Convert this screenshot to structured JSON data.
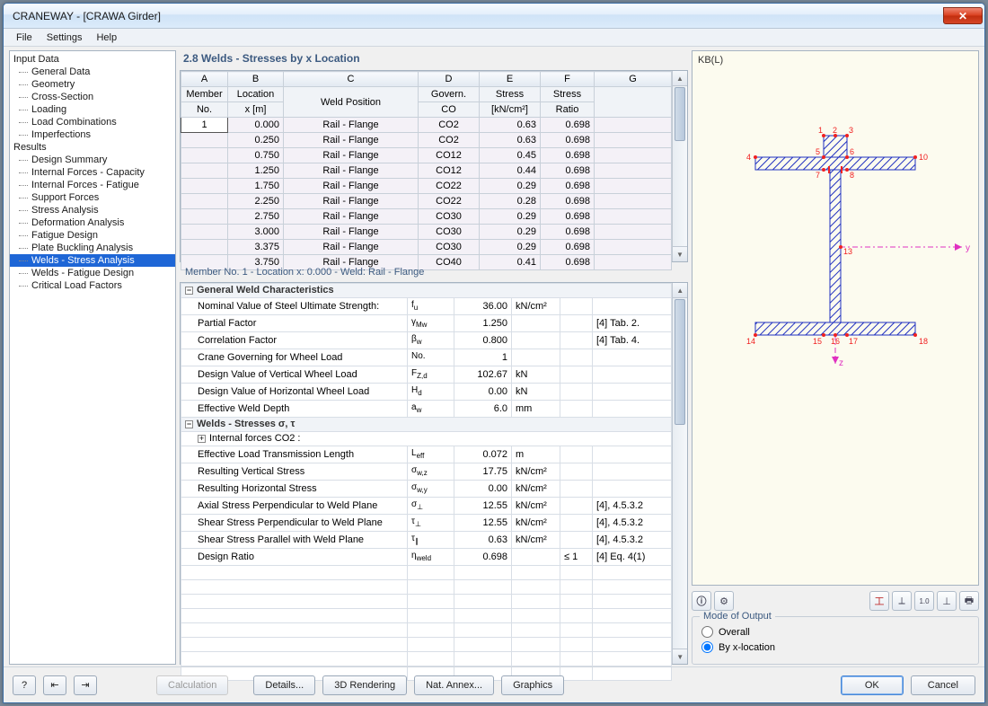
{
  "title": "CRANEWAY - [CRAWA Girder]",
  "menu": {
    "file": "File",
    "settings": "Settings",
    "help": "Help"
  },
  "nav": {
    "input_data": "Input Data",
    "general_data": "General Data",
    "geometry": "Geometry",
    "cross_section": "Cross-Section",
    "loading": "Loading",
    "load_comb": "Load Combinations",
    "imperf": "Imperfections",
    "results": "Results",
    "design_summary": "Design Summary",
    "int_cap": "Internal Forces - Capacity",
    "int_fat": "Internal Forces - Fatigue",
    "support": "Support Forces",
    "stress": "Stress Analysis",
    "deform": "Deformation Analysis",
    "fatigue": "Fatigue Design",
    "plate": "Plate Buckling Analysis",
    "welds_stress": "Welds - Stress Analysis",
    "welds_fat": "Welds - Fatigue Design",
    "crit": "Critical Load Factors"
  },
  "section_title": "2.8 Welds - Stresses by x Location",
  "grid": {
    "cols": {
      "A": "A",
      "B": "B",
      "C": "C",
      "D": "D",
      "E": "E",
      "F": "F",
      "G": "G"
    },
    "hdr": {
      "member": "Member",
      "no": "No.",
      "loc": "Location",
      "x": "x [m]",
      "weld": "Weld Position",
      "gov": "Govern.",
      "co": "CO",
      "stress": "Stress",
      "unit": "[kN/cm²]",
      "ratio": "Stress",
      "ratio2": "Ratio"
    },
    "rows": [
      {
        "m": "1",
        "x": "0.000",
        "wp": "Rail - Flange",
        "co": "CO2",
        "s": "0.63",
        "r": "0.698"
      },
      {
        "m": "",
        "x": "0.250",
        "wp": "Rail - Flange",
        "co": "CO2",
        "s": "0.63",
        "r": "0.698"
      },
      {
        "m": "",
        "x": "0.750",
        "wp": "Rail - Flange",
        "co": "CO12",
        "s": "0.45",
        "r": "0.698"
      },
      {
        "m": "",
        "x": "1.250",
        "wp": "Rail - Flange",
        "co": "CO12",
        "s": "0.44",
        "r": "0.698"
      },
      {
        "m": "",
        "x": "1.750",
        "wp": "Rail - Flange",
        "co": "CO22",
        "s": "0.29",
        "r": "0.698"
      },
      {
        "m": "",
        "x": "2.250",
        "wp": "Rail - Flange",
        "co": "CO22",
        "s": "0.28",
        "r": "0.698"
      },
      {
        "m": "",
        "x": "2.750",
        "wp": "Rail - Flange",
        "co": "CO30",
        "s": "0.29",
        "r": "0.698"
      },
      {
        "m": "",
        "x": "3.000",
        "wp": "Rail - Flange",
        "co": "CO30",
        "s": "0.29",
        "r": "0.698"
      },
      {
        "m": "",
        "x": "3.375",
        "wp": "Rail - Flange",
        "co": "CO30",
        "s": "0.29",
        "r": "0.698"
      },
      {
        "m": "",
        "x": "3.750",
        "wp": "Rail - Flange",
        "co": "CO40",
        "s": "0.41",
        "r": "0.698"
      }
    ]
  },
  "detail_title": "Member No.  1  -  Location x:  0.000  -  Weld: Rail - Flange",
  "details": {
    "group1": "General Weld Characteristics",
    "rows1": [
      {
        "p": "Nominal Value of Steel Ultimate Strength:",
        "s": "f",
        "sub": "u",
        "v": "36.00",
        "u": "kN/cm²",
        "ref": ""
      },
      {
        "p": "Partial Factor",
        "s": "γ",
        "sub": "Mw",
        "v": "1.250",
        "u": "",
        "ref": "[4] Tab. 2."
      },
      {
        "p": "Correlation Factor",
        "s": "β",
        "sub": "w",
        "v": "0.800",
        "u": "",
        "ref": "[4] Tab. 4."
      },
      {
        "p": "Crane Governing for Wheel Load",
        "s": "No.",
        "sub": "",
        "v": "1",
        "u": "",
        "ref": ""
      },
      {
        "p": "Design Value of Vertical Wheel Load",
        "s": "F",
        "sub": "Z,d",
        "v": "102.67",
        "u": "kN",
        "ref": ""
      },
      {
        "p": "Design Value of Horizontal Wheel Load",
        "s": "H",
        "sub": "d",
        "v": "0.00",
        "u": "kN",
        "ref": ""
      },
      {
        "p": "Effective Weld Depth",
        "s": "a",
        "sub": "w",
        "v": "6.0",
        "u": "mm",
        "ref": ""
      }
    ],
    "group2": "Welds - Stresses σ, τ",
    "sub2": "Internal forces CO2 :",
    "rows2": [
      {
        "p": "Effective Load Transmission Length",
        "s": "L",
        "sub": "eff",
        "v": "0.072",
        "u": "m",
        "ref": ""
      },
      {
        "p": "Resulting Vertical Stress",
        "s": "σ",
        "sub": "w,z",
        "v": "17.75",
        "u": "kN/cm²",
        "ref": ""
      },
      {
        "p": "Resulting Horizontal Stress",
        "s": "σ",
        "sub": "w,y",
        "v": "0.00",
        "u": "kN/cm²",
        "ref": ""
      },
      {
        "p": "Axial Stress Perpendicular to Weld Plane",
        "s": "σ",
        "sub": "⊥",
        "v": "12.55",
        "u": "kN/cm²",
        "ref": "[4], 4.5.3.2"
      },
      {
        "p": "Shear Stress Perpendicular to Weld Plane",
        "s": "τ",
        "sub": "⊥",
        "v": "12.55",
        "u": "kN/cm²",
        "ref": "[4], 4.5.3.2"
      },
      {
        "p": "Shear Stress Parallel with Weld Plane",
        "s": "τ",
        "sub": "∥",
        "v": "0.63",
        "u": "kN/cm²",
        "ref": "[4], 4.5.3.2"
      },
      {
        "p": "Design Ratio",
        "s": "η",
        "sub": "weld",
        "v": "0.698",
        "u": "",
        "lim": "≤ 1",
        "ref": "[4] Eq. 4(1)"
      }
    ]
  },
  "viewer": {
    "label": "KB(L)",
    "y": "y",
    "z": "z"
  },
  "modebox": {
    "title": "Mode of Output",
    "overall": "Overall",
    "byx": "By x-location"
  },
  "footer": {
    "calc": "Calculation",
    "details": "Details...",
    "render": "3D Rendering",
    "annex": "Nat. Annex...",
    "graphics": "Graphics",
    "ok": "OK",
    "cancel": "Cancel"
  },
  "chart_data": {
    "type": "table",
    "title": "2.8 Welds - Stresses by x Location",
    "columns": [
      "Member No.",
      "Location x [m]",
      "Weld Position",
      "Govern. CO",
      "Stress [kN/cm2]",
      "Stress Ratio"
    ],
    "rows": [
      [
        1,
        0.0,
        "Rail - Flange",
        "CO2",
        0.63,
        0.698
      ],
      [
        1,
        0.25,
        "Rail - Flange",
        "CO2",
        0.63,
        0.698
      ],
      [
        1,
        0.75,
        "Rail - Flange",
        "CO12",
        0.45,
        0.698
      ],
      [
        1,
        1.25,
        "Rail - Flange",
        "CO12",
        0.44,
        0.698
      ],
      [
        1,
        1.75,
        "Rail - Flange",
        "CO22",
        0.29,
        0.698
      ],
      [
        1,
        2.25,
        "Rail - Flange",
        "CO22",
        0.28,
        0.698
      ],
      [
        1,
        2.75,
        "Rail - Flange",
        "CO30",
        0.29,
        0.698
      ],
      [
        1,
        3.0,
        "Rail - Flange",
        "CO30",
        0.29,
        0.698
      ],
      [
        1,
        3.375,
        "Rail - Flange",
        "CO30",
        0.29,
        0.698
      ],
      [
        1,
        3.75,
        "Rail - Flange",
        "CO40",
        0.41,
        0.698
      ]
    ]
  }
}
